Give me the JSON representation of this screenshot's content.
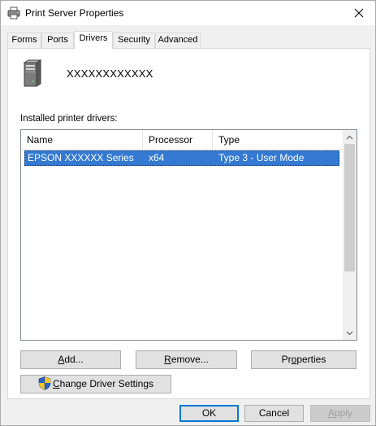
{
  "window": {
    "title": "Print Server Properties",
    "close_glyph": "✕"
  },
  "tabs": [
    {
      "label": "Forms"
    },
    {
      "label": "Ports"
    },
    {
      "label": "Drivers"
    },
    {
      "label": "Security"
    },
    {
      "label": "Advanced"
    }
  ],
  "server": {
    "name": "XXXXXXXXXXXX"
  },
  "drivers_list": {
    "label": "Installed printer drivers:",
    "columns": [
      "Name",
      "Processor",
      "Type"
    ],
    "rows": [
      {
        "name": "EPSON XXXXXX Series",
        "processor": "x64",
        "type": "Type 3 - User Mode",
        "selected": true
      }
    ]
  },
  "buttons": {
    "add": {
      "pre": "",
      "mn": "A",
      "post": "dd..."
    },
    "remove": {
      "pre": "",
      "mn": "R",
      "post": "emove..."
    },
    "properties": {
      "pre": "Pr",
      "mn": "o",
      "post": "perties"
    },
    "change_driver_settings": {
      "pre": "",
      "mn": "C",
      "post": "hange Driver Settings"
    },
    "ok": "OK",
    "cancel": "Cancel",
    "apply": {
      "pre": "",
      "mn": "A",
      "post": "pply"
    }
  },
  "colors": {
    "selection": "#3479d2",
    "default_button_border": "#0078d7",
    "dialog_background": "#f0f0f0"
  },
  "icons": {
    "title": "printer-icon",
    "server": "server-tower-icon",
    "close": "close-icon",
    "scroll_up": "chevron-up-icon",
    "scroll_down": "chevron-down-icon",
    "change_driver_settings": "uac-shield-icon"
  }
}
